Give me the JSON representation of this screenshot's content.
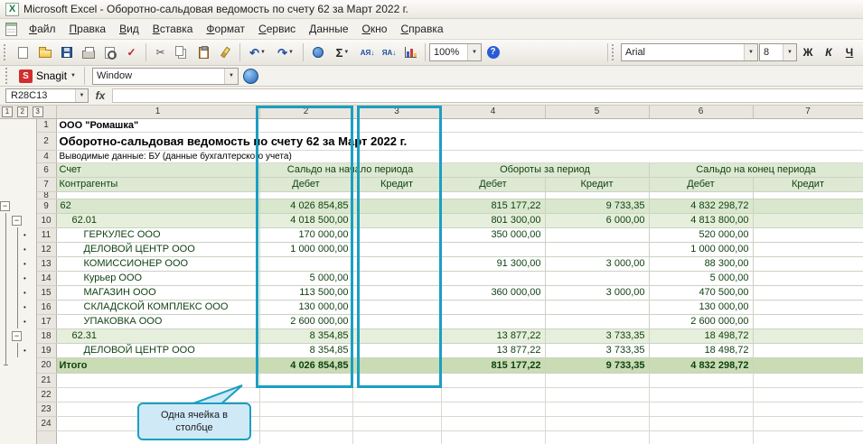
{
  "window": {
    "title": "Microsoft Excel - Оборотно-сальдовая ведомость по счету 62 за Март 2022 г."
  },
  "menu": {
    "items": [
      "Файл",
      "Правка",
      "Вид",
      "Вставка",
      "Формат",
      "Сервис",
      "Данные",
      "Окно",
      "Справка"
    ]
  },
  "toolbar": {
    "zoom_value": "100%",
    "font_name": "Arial",
    "font_size": "8",
    "bold_label": "Ж",
    "italic_label": "К",
    "underline_label": "Ч"
  },
  "snagit": {
    "label": "Snagit",
    "profile": "Window"
  },
  "formula_bar": {
    "name_box": "R28C13",
    "fx_label": "fx",
    "formula_value": ""
  },
  "icons": {
    "excel_logo": "X",
    "caret": "▼",
    "undo": "↶",
    "redo": "↷",
    "autosum": "Σ",
    "help": "?",
    "spelling": "✓",
    "cut": "✂",
    "sort_asc": "АЯ↓",
    "sort_desc": "ЯА↓",
    "outline_dot": "•",
    "outline_minus": "−"
  },
  "sheet": {
    "outline_levels": [
      "1",
      "2",
      "3"
    ],
    "col_headers": [
      "1",
      "2",
      "3",
      "4",
      "5",
      "6",
      "7"
    ],
    "row_numbers": {
      "company": "1",
      "title": "2",
      "note": "4",
      "header_top": "6",
      "header_bottom": "7",
      "spacer": "8",
      "total": "20"
    },
    "empty_row_numbers": [
      "21",
      "22",
      "23",
      "24"
    ],
    "report": {
      "company": "ООО \"Ромашка\"",
      "title": "Оборотно-сальдовая ведомость по счету 62 за Март 2022 г.",
      "note": "Выводимые данные: БУ (данные бухгалтерского учета)",
      "headers": {
        "account": "Счет",
        "counterparty": "Контрагенты",
        "opening": "Сальдо на начало периода",
        "turnover": "Обороты за период",
        "closing": "Сальдо на конец периода",
        "debit": "Дебет",
        "credit": "Кредит"
      }
    },
    "data_rows": [
      {
        "num": "9",
        "level": 1,
        "mark": "minus1",
        "name": "62",
        "od": "4 026 854,85",
        "td": "815 177,22",
        "tc": "9 733,35",
        "cd": "4 832 298,72"
      },
      {
        "num": "10",
        "level": 2,
        "mark": "minus2",
        "name": "62.01",
        "od": "4 018 500,00",
        "td": "801 300,00",
        "tc": "6 000,00",
        "cd": "4 813 800,00"
      },
      {
        "num": "11",
        "level": 3,
        "mark": "dot",
        "name": "ГЕРКУЛЕС ООО",
        "od": "170 000,00",
        "td": "350 000,00",
        "cd": "520 000,00"
      },
      {
        "num": "12",
        "level": 3,
        "mark": "dot",
        "name": "ДЕЛОВОЙ ЦЕНТР ООО",
        "od": "1 000 000,00",
        "cd": "1 000 000,00"
      },
      {
        "num": "13",
        "level": 3,
        "mark": "dot",
        "name": "КОМИССИОНЕР ООО",
        "td": "91 300,00",
        "tc": "3 000,00",
        "cd": "88 300,00"
      },
      {
        "num": "14",
        "level": 3,
        "mark": "dot",
        "name": "Курьер ООО",
        "od": "5 000,00",
        "cd": "5 000,00"
      },
      {
        "num": "15",
        "level": 3,
        "mark": "dot",
        "name": "МАГАЗИН ООО",
        "od": "113 500,00",
        "td": "360 000,00",
        "tc": "3 000,00",
        "cd": "470 500,00"
      },
      {
        "num": "16",
        "level": 3,
        "mark": "dot",
        "name": "СКЛАДСКОЙ КОМПЛЕКС ООО",
        "od": "130 000,00",
        "cd": "130 000,00"
      },
      {
        "num": "17",
        "level": 3,
        "mark": "dot",
        "name": "УПАКОВКА ООО",
        "od": "2 600 000,00",
        "cd": "2 600 000,00"
      },
      {
        "num": "18",
        "level": 2,
        "mark": "minus2",
        "name": "62.31",
        "od": "8 354,85",
        "td": "13 877,22",
        "tc": "3 733,35",
        "cd": "18 498,72"
      },
      {
        "num": "19",
        "level": 3,
        "mark": "dot",
        "name": "ДЕЛОВОЙ ЦЕНТР ООО",
        "od": "8 354,85",
        "td": "13 877,22",
        "tc": "3 733,35",
        "cd": "18 498,72"
      }
    ],
    "total_row": {
      "label": "Итого",
      "od": "4 026 854,85",
      "oc": "",
      "td": "815 177,22",
      "tc": "9 733,35",
      "cd": "4 832 298,72",
      "cc": ""
    }
  },
  "callout": {
    "text": "Одна ячейка в столбце"
  },
  "colors": {
    "accent": "#1b9fc0",
    "callout_fill": "#cfe9f7",
    "report_text": "#0e3f10",
    "header_fill": "#dde9d2",
    "level1_fill": "#d9e7cd",
    "level2_fill": "#e6efdb",
    "total_fill": "#c9dcb4"
  }
}
